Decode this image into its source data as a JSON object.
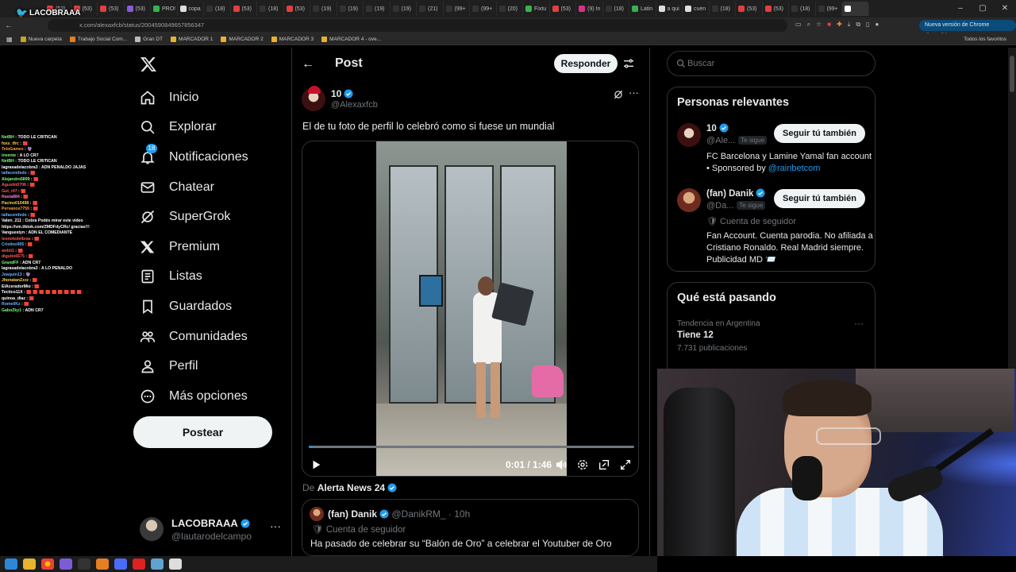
{
  "browser": {
    "tabs": [
      {
        "label": "(53)",
        "color": "#e04040"
      },
      {
        "label": "(53)",
        "color": "#e04040"
      },
      {
        "label": "(53)",
        "color": "#e04040"
      },
      {
        "label": "(53)",
        "color": "#8a5cd8"
      },
      {
        "label": "PRO!",
        "color": "#37b24d"
      },
      {
        "label": "copa",
        "color": "#dddddd"
      },
      {
        "label": "(18)",
        "color": "#333333"
      },
      {
        "label": "(53)",
        "color": "#e04040"
      },
      {
        "label": "(18)",
        "color": "#333333"
      },
      {
        "label": "(53)",
        "color": "#e04040"
      },
      {
        "label": "(19)",
        "color": "#333333"
      },
      {
        "label": "(19)",
        "color": "#333333"
      },
      {
        "label": "(19)",
        "color": "#333333"
      },
      {
        "label": "(19)",
        "color": "#333333"
      },
      {
        "label": "(21)",
        "color": "#333333"
      },
      {
        "label": "(99+",
        "color": "#333333"
      },
      {
        "label": "(99+",
        "color": "#333333"
      },
      {
        "label": "(20)",
        "color": "#333333"
      },
      {
        "label": "Fixtu",
        "color": "#37b24d"
      },
      {
        "label": "(53)",
        "color": "#e04040"
      },
      {
        "label": "(9) In",
        "color": "#d63384"
      },
      {
        "label": "(18)",
        "color": "#333333"
      },
      {
        "label": "Latin",
        "color": "#37b24d"
      },
      {
        "label": "a qui",
        "color": "#dddddd"
      },
      {
        "label": "cuen",
        "color": "#dddddd"
      },
      {
        "label": "(18)",
        "color": "#333333"
      },
      {
        "label": "(53)",
        "color": "#e04040"
      },
      {
        "label": "(53)",
        "color": "#e04040"
      },
      {
        "label": "(18)",
        "color": "#333333"
      },
      {
        "label": "(99+",
        "color": "#333333"
      },
      {
        "label": "",
        "color": "#ffffff",
        "active": true
      }
    ],
    "url": "x.com/alexaxfcb/status/2004590849657856347",
    "update_label": "Nueva versión de Chrome disponible",
    "bookmarks": [
      "Nueva carpeta",
      "Trabajo Social Com...",
      "Gran DT",
      "MARCADOR 1",
      "MARCADOR 2",
      "MARCADOR 3",
      "MARCADOR 4 - ove..."
    ],
    "all_bookmarks_label": "Todos los favoritos",
    "streamer_name": "LACOBRAAA"
  },
  "chat": [
    {
      "user": "NetBH",
      "msg": "TODO LE CRITICAN",
      "color": "#7cff7c"
    },
    {
      "user": "foxx_tfrc",
      "msg": "🟥",
      "color": "#ffd34d"
    },
    {
      "user": "TeloGames",
      "msg": "🔮",
      "color": "#ff9f40"
    },
    {
      "user": "invente",
      "msg": "A LO CR7",
      "color": "#7cff7c"
    },
    {
      "user": "NetBH",
      "msg": "TODO LE CRITICAN",
      "color": "#7cff7c"
    },
    {
      "user": "lagrasadelacobra3",
      "msg": "ADN PENALDO JAJAS",
      "color": "#ffffff"
    },
    {
      "user": "iaifacemfedo",
      "msg": "🟥",
      "color": "#6cb2ff"
    },
    {
      "user": "Alejandro5899",
      "msg": "🟥",
      "color": "#7cff7c"
    },
    {
      "user": "Agustin0706",
      "msg": "🟥",
      "color": "#ff5c5c"
    },
    {
      "user": "Gut_r07",
      "msg": "🟥",
      "color": "#ff5c5c"
    },
    {
      "user": "Rasta884",
      "msg": "🟥",
      "color": "#ff7ad9"
    },
    {
      "user": "Pacino010498",
      "msg": "🟥",
      "color": "#ffd34d"
    },
    {
      "user": "Pervanos7759",
      "msg": "🟥",
      "color": "#ff9f40"
    },
    {
      "user": "iaifacemfedo",
      "msg": "🟥",
      "color": "#6cb2ff"
    },
    {
      "user": "Valen_211",
      "msg": "Cobra Podés mirar este video",
      "color": "#ffffff"
    },
    {
      "user": "",
      "msg": "https://vm.tiktok.com/ZMDFdyCRc/ gracias!!!",
      "color": "#ffffff"
    },
    {
      "user": "Vanguestyn",
      "msg": "ADN EL COMEDIANTE",
      "color": "#ffffff"
    },
    {
      "user": "leonoledelbras",
      "msg": "🟥",
      "color": "#ff5c5c"
    },
    {
      "user": "Cristino905",
      "msg": "🟥",
      "color": "#6cb2ff"
    },
    {
      "user": "webli1",
      "msg": "🟥",
      "color": "#ff5c5c"
    },
    {
      "user": "diguito6675",
      "msg": "🟥",
      "color": "#ff5c5c"
    },
    {
      "user": "GrandFF",
      "msg": "ADN CR7",
      "color": "#7cff7c"
    },
    {
      "user": "lagrasadelacobra3",
      "msg": "A LO PENALDO",
      "color": "#ffffff"
    },
    {
      "user": "Joaquin13",
      "msg": "🔮",
      "color": "#6cb2ff"
    },
    {
      "user": "JhonatanZzzz",
      "msg": "🟥",
      "color": "#ffd34d"
    },
    {
      "user": "ElAceradorMio",
      "msg": "🟥",
      "color": "#ffffff"
    },
    {
      "user": "Tectico11X",
      "msg": "🟥 🟥 🟥 🟥 🟥 🟥 🟥 🟥 🟥",
      "color": "#ffffff"
    },
    {
      "user": "quinoa_diaz",
      "msg": "🟥",
      "color": "#ffffff"
    },
    {
      "user": "Rome0Kz",
      "msg": "🟥",
      "color": "#6cb2ff"
    },
    {
      "user": "GaboZky1",
      "msg": "ADN CR7",
      "color": "#7cff7c"
    }
  ],
  "sidebar": {
    "items": [
      {
        "label": "Inicio",
        "icon": "home-icon"
      },
      {
        "label": "Explorar",
        "icon": "search-icon"
      },
      {
        "label": "Notificaciones",
        "icon": "bell-icon",
        "badge": "18"
      },
      {
        "label": "Chatear",
        "icon": "mail-icon"
      },
      {
        "label": "SuperGrok",
        "icon": "grok-icon"
      },
      {
        "label": "Premium",
        "icon": "x-premium-icon"
      },
      {
        "label": "Listas",
        "icon": "list-icon"
      },
      {
        "label": "Guardados",
        "icon": "bookmark-icon"
      },
      {
        "label": "Comunidades",
        "icon": "people-icon"
      },
      {
        "label": "Perfil",
        "icon": "person-icon"
      },
      {
        "label": "Más opciones",
        "icon": "more-circle-icon"
      }
    ],
    "post_button": "Postear",
    "account": {
      "name": "LACOBRAAA",
      "handle": "@lautarodelcampo"
    }
  },
  "post": {
    "header_title": "Post",
    "reply_button": "Responder",
    "author_name": "10",
    "author_handle": "@Alexaxfcb",
    "text": "El de tu foto de perfil lo celebró como si fuese un mundial",
    "video": {
      "time": "0:01 / 1:46",
      "progress": 0.01
    },
    "quote_from_prefix": "De",
    "quote_from_name": "Alerta News 24",
    "quote": {
      "name": "(fan) Danik",
      "handle": "@DanikRM_ · 10h",
      "label": "Cuenta de seguidor",
      "text": "Ha pasado de celebrar su “Balón de Oro” a celebrar el Youtuber de Oro"
    }
  },
  "right": {
    "search_placeholder": "Buscar",
    "relevant_title": "Personas relevantes",
    "people": [
      {
        "name": "10",
        "handle": "@Ale...",
        "follows_you": "Te sigue",
        "follow_label": "Seguir tú también",
        "bio": "FC Barcelona y Lamine Yamal fan account • Sponsored by ",
        "bio_link": "@rainbetcom"
      },
      {
        "name": "(fan) Danik",
        "handle": "@Da...",
        "follows_you": "Te sigue",
        "follow_label": "Seguir tú también",
        "label": "Cuenta de seguidor",
        "bio": "Fan Account. Cuenta parodia. No afiliada a Cristiano Ronaldo. Real Madrid siempre. Publicidad MD 📨"
      }
    ],
    "trending_title": "Qué está pasando",
    "trend": {
      "category": "Tendencia en Argentina",
      "name": "Tiene 12",
      "count": "7.731 publicaciones"
    }
  },
  "colors": {
    "accent": "#1d9bf0",
    "background": "#000000",
    "border": "#2f3336",
    "muted": "#71767b"
  }
}
